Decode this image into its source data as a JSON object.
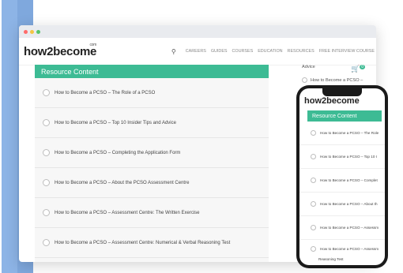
{
  "site": {
    "logo": "how2become",
    "logo_suffix": "com"
  },
  "nav": {
    "items": [
      "CAREERS",
      "GUIDES",
      "COURSES",
      "EDUCATION",
      "RESOURCES",
      "FREE INTERVIEW COURSE"
    ]
  },
  "resource": {
    "title": "Resource Content",
    "items": [
      "How to Become a PCSO – The Role of a PCSO",
      "How to Become a PCSO – Top 10 Insider Tips and Advice",
      "How to Become a PCSO – Completing the Application Form",
      "How to Become a PCSO – About the PCSO Assessment Centre",
      "How to Become a PCSO – Assessment Centre: The Written Exercise",
      "How to Become a PCSO – Assessment Centre: Numerical & Verbal Reasoning Test"
    ]
  },
  "sidebar": {
    "advice": "Advice",
    "link": "How to Become a PCSO –",
    "cart_count": "0"
  },
  "phone": {
    "logo": "how2become",
    "title": "Resource Content",
    "items": [
      "How to Become a PCSO – The Role",
      "How to Become a PCSO – Top 10 I",
      "How to Become a PCSO – Complet",
      "How to Become a PCSO – About th",
      "How to Become a PCSO – Assessm",
      "How to Become a PCSO – Assessm"
    ],
    "last_line": "Reasoning Test"
  },
  "colors": {
    "accent": "#3dbb94",
    "blue": "#7fa8dd"
  }
}
